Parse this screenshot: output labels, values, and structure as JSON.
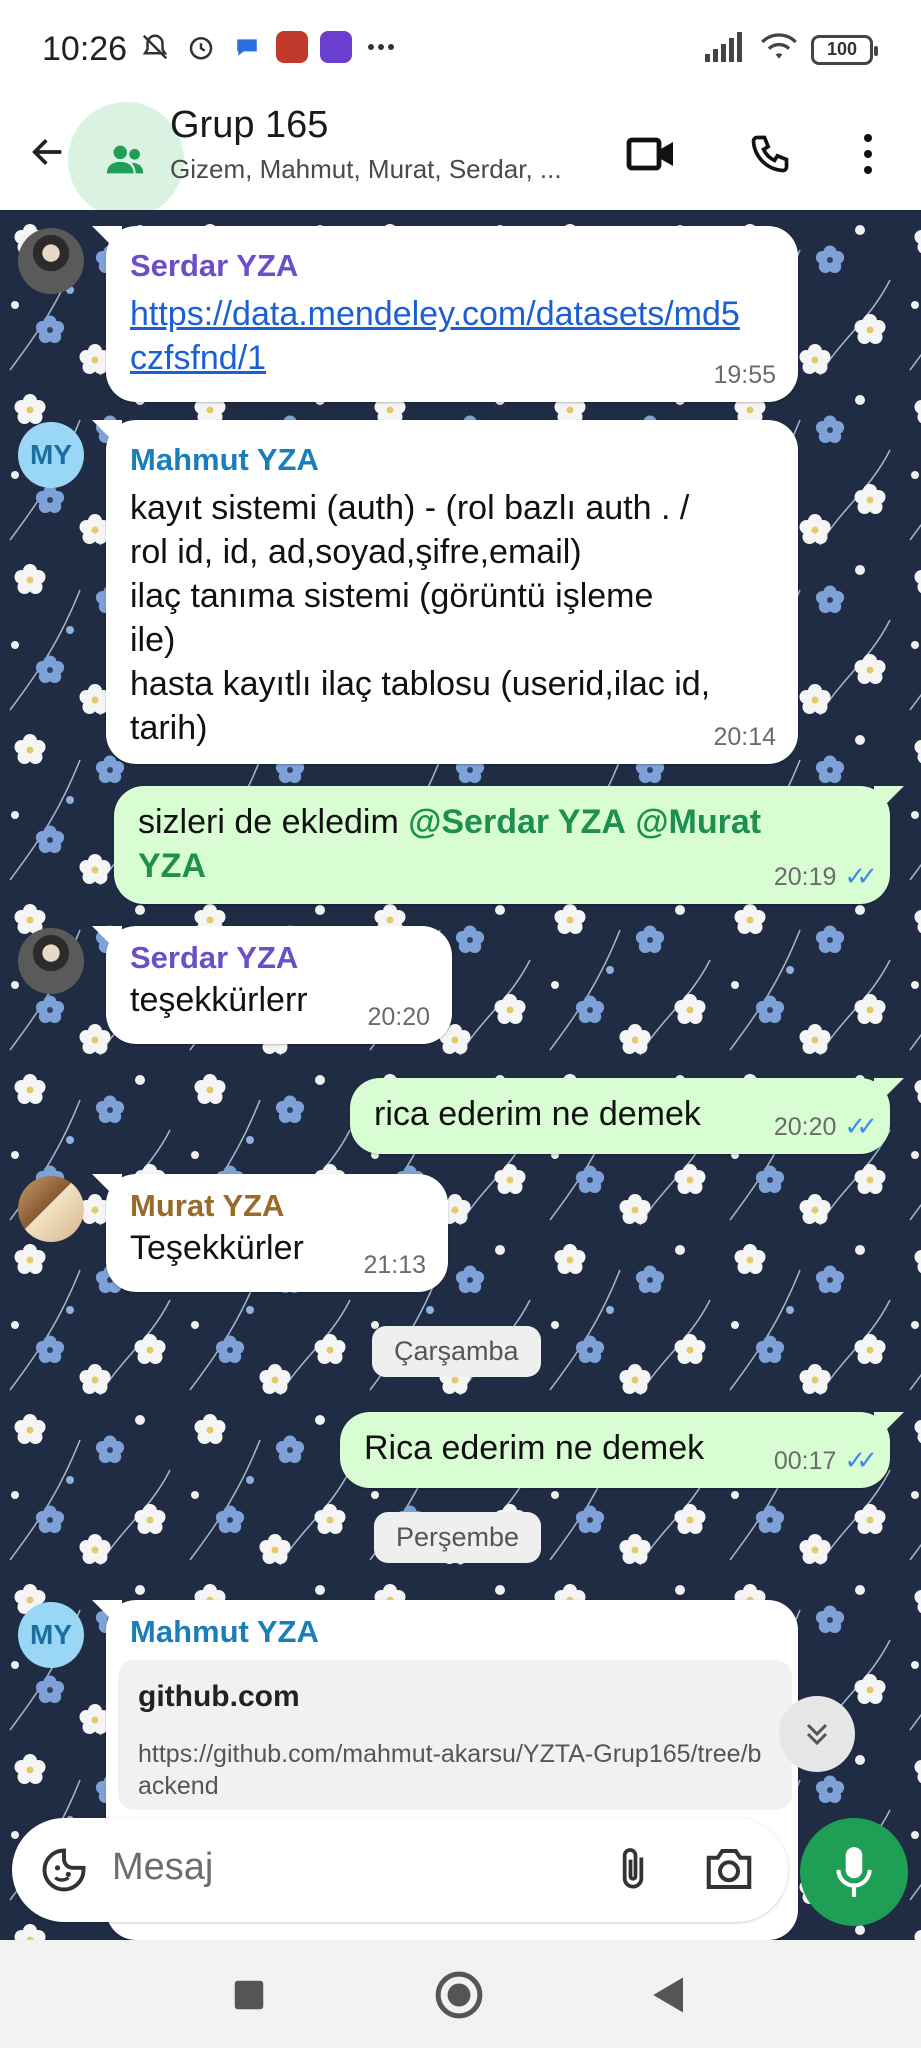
{
  "status_bar": {
    "time": "10:26",
    "battery": "100"
  },
  "header": {
    "title": "Grup 165",
    "subtitle": "Gizem, Mahmut, Murat, Serdar, ..."
  },
  "messages": [
    {
      "sender": "Serdar YZA",
      "text": "https://data.mendeley.com/datasets/md5czfsfnd/1",
      "time": "19:55"
    },
    {
      "sender": "Mahmut YZA",
      "avatar_initials": "MY",
      "lines": [
        "kayıt sistemi (auth) - (rol bazlı auth . /",
        "rol id, id, ad,soyad,şifre,email)",
        "ilaç tanıma sistemi (görüntü işleme",
        "ile)",
        "hasta kayıtlı ilaç tablosu (userid,ilac id,",
        "tarih)"
      ],
      "time": "20:14"
    },
    {
      "text_prefix": "sizleri de ekledim ",
      "mention1": "@Serdar YZA",
      "mention2": "@Murat",
      "mention2_cont": "YZA",
      "time": "20:19"
    },
    {
      "sender": "Serdar YZA",
      "text": "teşekkürlerr",
      "time": "20:20"
    },
    {
      "text": "rica ederim ne demek",
      "time": "20:20"
    },
    {
      "sender": "Murat YZA",
      "text": "Teşekkürler",
      "time": "21:13"
    },
    {
      "text": "Rica ederim ne demek",
      "time": "00:17"
    },
    {
      "sender": "Mahmut YZA",
      "avatar_initials": "MY",
      "preview_domain": "github.com",
      "preview_url": "https://github.com/mahmut-akarsu/YZTA-Grup165/tree/backend"
    }
  ],
  "day_separators": [
    "Çarşamba",
    "Perşembe"
  ],
  "input": {
    "placeholder": "Mesaj"
  },
  "colors": {
    "accent": "#1f9f55",
    "incoming": "#ffffff",
    "outgoing": "#d9fdd3",
    "wallpaper": "#1f2c44"
  }
}
